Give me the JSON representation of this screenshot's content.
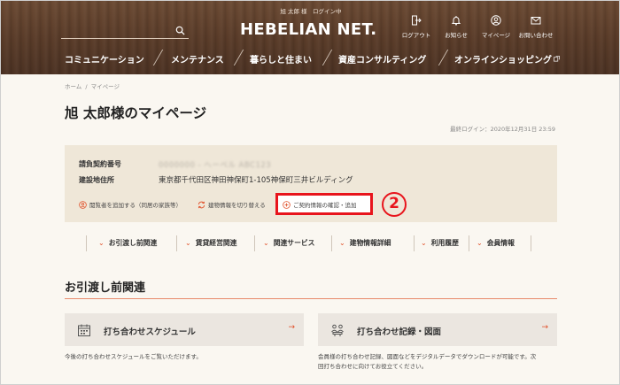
{
  "header": {
    "user_status": "旭 太郎 様　ログイン中",
    "logo": "HEBELIAN NET.",
    "search_placeholder": "",
    "util_nav": [
      {
        "label": "ログアウト",
        "icon": "logout-icon"
      },
      {
        "label": "お知らせ",
        "icon": "bell-icon"
      },
      {
        "label": "マイページ",
        "icon": "user-icon"
      },
      {
        "label": "お問い合わせ",
        "icon": "mail-icon"
      }
    ],
    "main_nav": [
      {
        "label": "コミュニケーション"
      },
      {
        "label": "メンテナンス"
      },
      {
        "label": "暮らしと住まい"
      },
      {
        "label": "資産コンサルティング"
      },
      {
        "label": "オンラインショッピング"
      }
    ]
  },
  "breadcrumb": {
    "home": "ホーム",
    "separator": "/",
    "current": "マイページ"
  },
  "page_title": "旭 太郎様のマイページ",
  "last_login": "最終ログイン：2020年12月31日 23:59",
  "contract": {
    "number_label": "請負契約番号",
    "number_value": "0000000 - ヘーベル ABC123",
    "address_label": "建設地住所",
    "address_value": "東京都千代田区神田神保町1-105神保町三井ビルディング",
    "actions": [
      {
        "label": "閲覧者を追加する（同居の家族等）",
        "icon": "add-user-icon"
      },
      {
        "label": "建物情報を切り替える",
        "icon": "switch-icon"
      },
      {
        "label": "ご契約情報の確認・追加",
        "icon": "plus-circle-icon"
      }
    ],
    "callout_number": "2"
  },
  "anchor_nav": [
    {
      "label": "お引渡し前関連"
    },
    {
      "label": "賃貸経営関連"
    },
    {
      "label": "関連サービス"
    },
    {
      "label": "建物情報詳細"
    },
    {
      "label": "利用履歴"
    },
    {
      "label": "会員情報"
    }
  ],
  "section": {
    "title": "お引渡し前関連",
    "cards": [
      {
        "title": "打ち合わせスケジュール",
        "icon": "calendar-icon",
        "desc": "今後の打ち合わせスケジュールをご覧いただけます。"
      },
      {
        "title": "打ち合わせ記録・図面",
        "icon": "meeting-icon",
        "desc_line1": "会員様の打ち合わせ記録、図面などをデジタルデータでダウンロードが可能です。次",
        "desc_line2": "回打ち合わせに向けてお役立てください。"
      }
    ]
  },
  "colors": {
    "header_wood": "#5a3c29",
    "accent": "#e0502a",
    "panel": "#efe7d8",
    "highlight": "#e8141c"
  }
}
